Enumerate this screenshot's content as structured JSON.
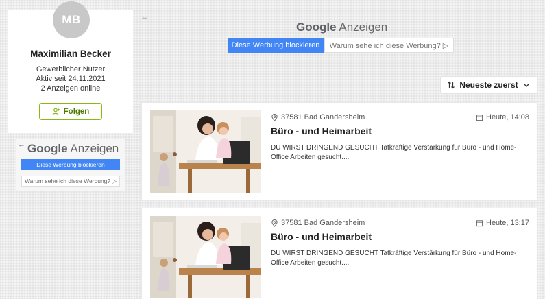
{
  "profile": {
    "initials": "MB",
    "name": "Maximilian Becker",
    "type": "Gewerblicher Nutzer",
    "active_since": "Aktiv seit 24.11.2021",
    "ads_online": "2 Anzeigen online",
    "follow_label": "Folgen"
  },
  "ads": {
    "brand": "Google",
    "label": "Anzeigen",
    "block_label": "Diese Werbung blockieren",
    "why_label": "Warum sehe ich diese Werbung? ▷"
  },
  "sort": {
    "label": "Neueste zuerst"
  },
  "listings": [
    {
      "location": "37581 Bad Gandersheim",
      "date": "Heute, 14:08",
      "title": "Büro - und Heimarbeit",
      "description": "DU WIRST DRINGEND GESUCHT Tatkräftige Verstärkung für Büro - und Home-Office Arbeiten gesucht...."
    },
    {
      "location": "37581 Bad Gandersheim",
      "date": "Heute, 13:17",
      "title": "Büro - und Heimarbeit",
      "description": "DU WIRST DRINGEND GESUCHT Tatkräftige Verstärkung für Büro - und Home-Office Arbeiten gesucht...."
    }
  ],
  "colors": {
    "accent_green": "#86b817",
    "google_blue": "#4285f4"
  }
}
